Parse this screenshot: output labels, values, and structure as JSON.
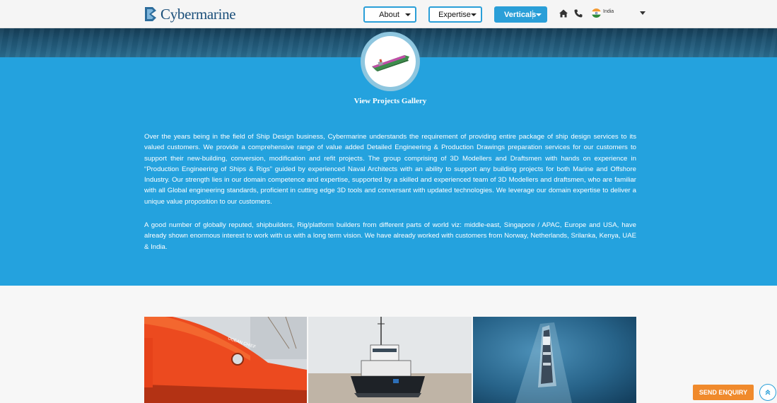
{
  "header": {
    "logo_text": "Cybermarine",
    "nav": {
      "about_label": "About",
      "expertise_label": "Expertise",
      "verticals_label": "Verticals"
    },
    "home_icon": "home-icon",
    "phone_icon": "phone-icon",
    "country": "India",
    "flag_icon": "india-flag-icon"
  },
  "gallery": {
    "title": "View Projects Gallery",
    "icon": "ship-model-icon"
  },
  "content": {
    "paragraph1": "Over the years being in the field of Ship Design business, Cybermarine understands the requirement of providing entire package of ship design services to its valued customers. We provide a comprehensive range of value added Detailed Engineering & Production Drawings preparation services for our customers to support their new-building, conversion, modification and refit projects. The group comprising of 3D Modellers and Draftsmen with hands on experience in “Production Engineering of Ships & Rigs” guided by experienced Naval Architects with an ability to support any building projects for both Marine and Offshore Industry. Our strength lies in our domain competence and expertise, supported by a skilled and experienced team of 3D Modellers and draftsmen, who are familiar with all Global engineering standards, proficient in cutting edge 3D tools and conversant with updated technologies. We leverage our domain expertise to deliver a unique value proposition to our customers.",
    "paragraph2": "A good number of globally reputed, shipbuilders, Rig/platform builders from different parts of world viz: middle-east, Singapore / APAC, Europe and USA, have already shown enormous interest to work with us with a long term vision. We have already worked with customers from Norway, Netherlands, Srilanka, Kenya, UAE & India."
  },
  "photos": [
    {
      "subject": "orange-tanker-bow-photo"
    },
    {
      "subject": "tugboat-photo"
    },
    {
      "subject": "ship-at-sea-aerial-photo"
    }
  ],
  "actions": {
    "enquiry_label": "SEND ENQUIRY",
    "to_top_icon": "scroll-to-top-icon"
  },
  "colors": {
    "brand_blue": "#24a2de",
    "nav_border": "#2a9fd8",
    "enquiry_orange": "#f08a2c",
    "logo_navy": "#1b4f7a"
  }
}
